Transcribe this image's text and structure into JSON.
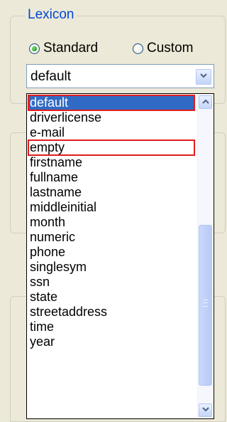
{
  "lexicon": {
    "title": "Lexicon",
    "radio_standard": {
      "label": "Standard",
      "checked": true
    },
    "radio_custom": {
      "label": "Custom",
      "checked": false
    },
    "combo": {
      "value": "default"
    },
    "dropdown": {
      "items": [
        "default",
        "driverlicense",
        "e-mail",
        "empty",
        "firstname",
        "fullname",
        "lastname",
        "middleinitial",
        "month",
        "numeric",
        "phone",
        "singlesym",
        "ssn",
        "state",
        "streetaddress",
        "time",
        "year"
      ],
      "selected_item": "default",
      "highlighted_items": [
        "default",
        "empty"
      ],
      "scroll_position_fraction": 0.48,
      "visible_fraction": 0.6
    }
  },
  "icons": {
    "combo_arrow": "chevron-down-icon",
    "scroll_up": "chevron-up-icon",
    "scroll_down": "chevron-down-icon"
  },
  "colors": {
    "selection": "#316ac5",
    "highlight_outline": "#e11d1d",
    "groupbox_title": "#0046d5"
  }
}
